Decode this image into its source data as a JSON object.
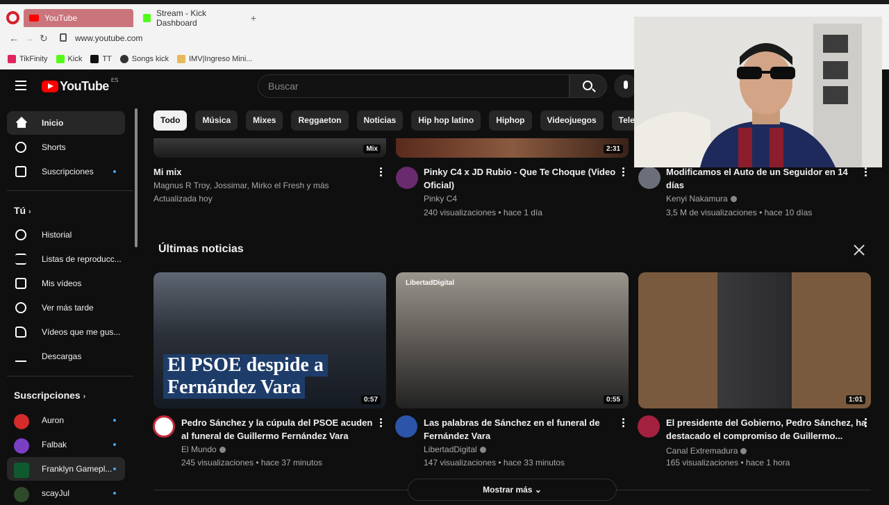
{
  "browser": {
    "tabs": [
      {
        "label": "YouTube",
        "active": true
      },
      {
        "label": "Stream - Kick Dashboard",
        "active": false
      }
    ],
    "url": "www.youtube.com",
    "bookmarks": [
      "TikFinity",
      "Kick",
      "TT",
      "Songs kick",
      "IMV|Ingreso Mini..."
    ]
  },
  "header": {
    "logo_text": "YouTube",
    "region": "ES",
    "search_placeholder": "Buscar"
  },
  "sidebar": {
    "main": [
      {
        "label": "Inicio",
        "icon": "home-icon"
      },
      {
        "label": "Shorts",
        "icon": "shorts-icon"
      },
      {
        "label": "Suscripciones",
        "icon": "subscriptions-icon"
      }
    ],
    "you_label": "Tú",
    "you_items": [
      {
        "label": "Historial",
        "icon": "history-icon"
      },
      {
        "label": "Listas de reproducc...",
        "icon": "playlists-icon"
      },
      {
        "label": "Mis vídeos",
        "icon": "my-videos-icon"
      },
      {
        "label": "Ver más tarde",
        "icon": "watch-later-icon"
      },
      {
        "label": "Vídeos que me gus...",
        "icon": "liked-icon"
      },
      {
        "label": "Descargas",
        "icon": "download-icon"
      }
    ],
    "subs_label": "Suscripciones",
    "subs": [
      {
        "label": "Auron",
        "color": "#d62b2b"
      },
      {
        "label": "Falbak",
        "color": "#7b3fc4"
      },
      {
        "label": "Franklyn Gamepl...",
        "color": "#0e5a2e"
      },
      {
        "label": "scayJul",
        "color": "#2f4a2a"
      }
    ]
  },
  "chips": [
    "Todo",
    "Música",
    "Mixes",
    "Reggaeton",
    "Noticias",
    "Hip hop latino",
    "Hiphop",
    "Videojuegos",
    "Telenovelas"
  ],
  "top_row": [
    {
      "title1": "Mi mix",
      "title2": "",
      "channel": "Magnus R Troy, Jossimar, Mirko el Fresh y más",
      "meta": "Actualizada hoy",
      "badge": "Mix"
    },
    {
      "title1": "Pinky C4 x JD Rubio - Que Te Choque (Video",
      "title2": "Oficial)",
      "channel": "Pinky C4",
      "meta": "240 visualizaciones • hace 1 día",
      "badge": "2:31"
    },
    {
      "title1": "Modificamos el Auto de un Seguidor en 14",
      "title2": "días",
      "channel": "Kenyi Nakamura",
      "meta": "3,5 M de visualizaciones • hace 10 días",
      "badge": ""
    }
  ],
  "news": {
    "section_title": "Últimas noticias",
    "overlay_line1": "El PSOE despide a",
    "overlay_line2": "Fernández Vara",
    "logo_tag": "LibertadDigital",
    "items": [
      {
        "title1": "Pedro Sánchez y la cúpula del PSOE acuden",
        "title2": "al funeral de Guillermo Fernández Vara",
        "channel": "El Mundo",
        "meta": "245 visualizaciones • hace 37 minutos",
        "duration": "0:57"
      },
      {
        "title1": "Las palabras de Sánchez en el funeral de",
        "title2": "Fernández Vara",
        "channel": "LibertadDigital",
        "meta": "147 visualizaciones • hace 33 minutos",
        "duration": "0:55"
      },
      {
        "title1": "El presidente del Gobierno, Pedro Sánchez, ha",
        "title2": "destacado el compromiso de Guillermo...",
        "channel": "Canal Extremadura",
        "meta": "165 visualizaciones • hace 1 hora",
        "duration": "1:01"
      }
    ],
    "more_label": "Mostrar más"
  }
}
